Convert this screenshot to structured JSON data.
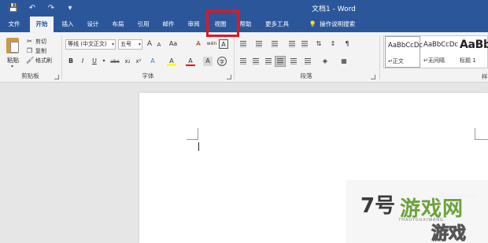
{
  "title_bar": {
    "document_title": "文档1  -  Word",
    "qat": [
      {
        "name": "save-icon",
        "glyph": "💾"
      },
      {
        "name": "undo-icon",
        "glyph": "↶"
      },
      {
        "name": "redo-icon",
        "glyph": "↷"
      },
      {
        "name": "qat-dropdown-icon",
        "glyph": "▾"
      }
    ]
  },
  "tabs": [
    {
      "label": "文件"
    },
    {
      "label": "开始",
      "active": true
    },
    {
      "label": "插入"
    },
    {
      "label": "设计"
    },
    {
      "label": "布局"
    },
    {
      "label": "引用"
    },
    {
      "label": "邮件"
    },
    {
      "label": "审阅"
    },
    {
      "label": "视图",
      "highlighted": true
    },
    {
      "label": "帮助"
    },
    {
      "label": "更多工具"
    },
    {
      "label": "操作说明搜索",
      "icon": "lightbulb-icon"
    }
  ],
  "ribbon": {
    "clipboard": {
      "group_label": "剪贴板",
      "paste_label": "粘贴",
      "cut_label": "剪切",
      "copy_label": "复制",
      "format_painter_label": "格式刷"
    },
    "font": {
      "group_label": "字体",
      "font_name": "等线 (中文正文)",
      "font_size": "五号",
      "buttons_row1": [
        "A",
        "A",
        "Aa",
        "A̶",
        "wén",
        "A"
      ],
      "buttons_row2": [
        "B",
        "I",
        "U",
        "abc",
        "x₂",
        "x²",
        "A",
        "A",
        "A",
        "A",
        "字"
      ]
    },
    "paragraph": {
      "group_label": "段落"
    },
    "styles": {
      "group_label": "样",
      "items": [
        {
          "preview": "AaBbCcDc",
          "name": "↵正文",
          "selected": true
        },
        {
          "preview": "AaBbCcDc",
          "name": "↵无间隔"
        },
        {
          "preview": "AaBb",
          "name": "标题 1"
        }
      ]
    }
  },
  "watermark": {
    "logo": "7号",
    "name": "游戏网",
    "url": "7haoyx.com",
    "pinyin": "7HAOYOUXIWANG",
    "bottom": "游戏"
  }
}
